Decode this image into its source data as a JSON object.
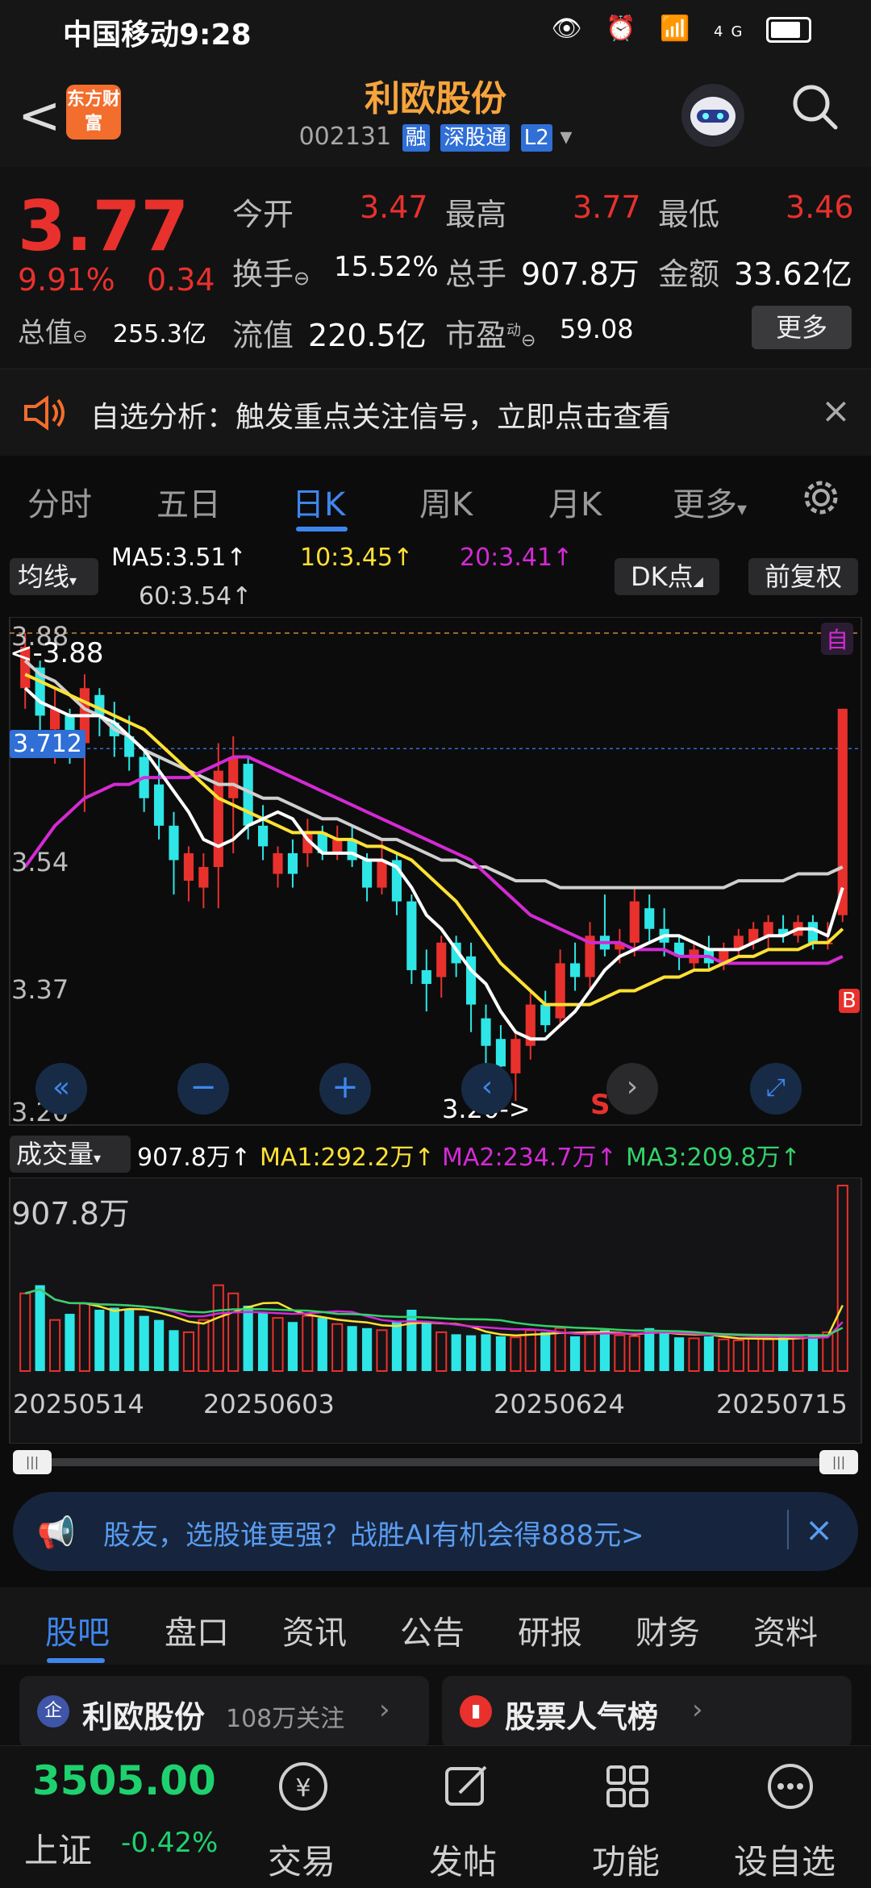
{
  "status_bar": {
    "carrier_time": "中国移动9:28",
    "network": "4G"
  },
  "header": {
    "back": "<",
    "logo_text": "东方财富",
    "title": "利欧股份",
    "code": "002131",
    "tags": [
      "融",
      "深股通",
      "L2"
    ]
  },
  "quote": {
    "price": "3.77",
    "pct_change": "9.91%",
    "change": "0.34",
    "open_label": "今开",
    "open": "3.47",
    "high_label": "最高",
    "high": "3.77",
    "low_label": "最低",
    "low": "3.46",
    "turnover_label": "换手",
    "turnover": "15.52%",
    "volume_label": "总手",
    "volume": "907.8万",
    "amount_label": "金额",
    "amount": "33.62亿",
    "mktcap_label": "总值",
    "mktcap": "255.3亿",
    "float_label": "流值",
    "float_cap": "220.5亿",
    "pe_label": "市盈",
    "pe_sup": "动",
    "pe": "59.08",
    "more": "更多"
  },
  "notice": {
    "text": "自选分析：触发重点关注信号，立即点击查看",
    "close": "×"
  },
  "chart_tabs": [
    "分时",
    "五日",
    "日K",
    "周K",
    "月K",
    "更多"
  ],
  "chart_tabs_active": "日K",
  "ma_bar": {
    "button": "均线",
    "ma5": "MA5:3.51↑",
    "ma10": "10:3.45↑",
    "ma20": "20:3.41↑",
    "ma60": "60:3.54↑",
    "dk": "DK点",
    "adjust": "前复权"
  },
  "price_axis": {
    "top": "3.88",
    "mid1": "3.54",
    "mid2": "3.37",
    "bottom": "3.20",
    "marker": "3.712"
  },
  "annotations": {
    "high_mark": "<-3.88",
    "low_mark": "3.20->",
    "sell": "S",
    "buy": "B",
    "self": "自"
  },
  "volume_bar": {
    "button": "成交量",
    "vol": "907.8万↑",
    "ma1": "MA1:292.2万↑",
    "ma2": "MA2:234.7万↑",
    "ma3": "MA3:209.8万↑",
    "axis_max": "907.8万"
  },
  "dates": [
    "20250514",
    "20250603",
    "20250624",
    "20250715"
  ],
  "colors": {
    "up": "#e8312c",
    "down": "#2ee6e6",
    "ma5": "#ffffff",
    "ma10": "#ffe133",
    "ma20": "#d42ad4",
    "ma60": "#cfcfcf"
  },
  "chart_data": {
    "type": "candlestick",
    "y_range": [
      3.2,
      3.88
    ],
    "candles": [
      {
        "o": 3.8,
        "h": 3.88,
        "l": 3.77,
        "c": 3.86
      },
      {
        "o": 3.83,
        "h": 3.84,
        "l": 3.73,
        "c": 3.76
      },
      {
        "o": 3.74,
        "h": 3.8,
        "l": 3.69,
        "c": 3.77
      },
      {
        "o": 3.76,
        "h": 3.77,
        "l": 3.69,
        "c": 3.71
      },
      {
        "o": 3.72,
        "h": 3.82,
        "l": 3.62,
        "c": 3.8
      },
      {
        "o": 3.79,
        "h": 3.8,
        "l": 3.73,
        "c": 3.76
      },
      {
        "o": 3.75,
        "h": 3.78,
        "l": 3.7,
        "c": 3.73
      },
      {
        "o": 3.73,
        "h": 3.76,
        "l": 3.68,
        "c": 3.7
      },
      {
        "o": 3.7,
        "h": 3.71,
        "l": 3.62,
        "c": 3.64
      },
      {
        "o": 3.66,
        "h": 3.7,
        "l": 3.58,
        "c": 3.6
      },
      {
        "o": 3.6,
        "h": 3.62,
        "l": 3.5,
        "c": 3.55
      },
      {
        "o": 3.52,
        "h": 3.57,
        "l": 3.49,
        "c": 3.56
      },
      {
        "o": 3.51,
        "h": 3.56,
        "l": 3.48,
        "c": 3.54
      },
      {
        "o": 3.54,
        "h": 3.72,
        "l": 3.48,
        "c": 3.68
      },
      {
        "o": 3.64,
        "h": 3.73,
        "l": 3.56,
        "c": 3.7
      },
      {
        "o": 3.69,
        "h": 3.7,
        "l": 3.58,
        "c": 3.6
      },
      {
        "o": 3.6,
        "h": 3.63,
        "l": 3.55,
        "c": 3.57
      },
      {
        "o": 3.53,
        "h": 3.57,
        "l": 3.51,
        "c": 3.56
      },
      {
        "o": 3.56,
        "h": 3.58,
        "l": 3.51,
        "c": 3.53
      },
      {
        "o": 3.56,
        "h": 3.61,
        "l": 3.54,
        "c": 3.59
      },
      {
        "o": 3.59,
        "h": 3.6,
        "l": 3.55,
        "c": 3.56
      },
      {
        "o": 3.56,
        "h": 3.6,
        "l": 3.55,
        "c": 3.58
      },
      {
        "o": 3.58,
        "h": 3.6,
        "l": 3.54,
        "c": 3.55
      },
      {
        "o": 3.55,
        "h": 3.56,
        "l": 3.49,
        "c": 3.51
      },
      {
        "o": 3.51,
        "h": 3.58,
        "l": 3.5,
        "c": 3.55
      },
      {
        "o": 3.55,
        "h": 3.56,
        "l": 3.47,
        "c": 3.49
      },
      {
        "o": 3.49,
        "h": 3.5,
        "l": 3.37,
        "c": 3.39
      },
      {
        "o": 3.39,
        "h": 3.42,
        "l": 3.33,
        "c": 3.37
      },
      {
        "o": 3.38,
        "h": 3.44,
        "l": 3.35,
        "c": 3.43
      },
      {
        "o": 3.43,
        "h": 3.44,
        "l": 3.38,
        "c": 3.4
      },
      {
        "o": 3.41,
        "h": 3.43,
        "l": 3.3,
        "c": 3.34
      },
      {
        "o": 3.32,
        "h": 3.34,
        "l": 3.25,
        "c": 3.28
      },
      {
        "o": 3.29,
        "h": 3.31,
        "l": 3.23,
        "c": 3.25
      },
      {
        "o": 3.24,
        "h": 3.3,
        "l": 3.2,
        "c": 3.29
      },
      {
        "o": 3.28,
        "h": 3.36,
        "l": 3.26,
        "c": 3.34
      },
      {
        "o": 3.34,
        "h": 3.36,
        "l": 3.3,
        "c": 3.31
      },
      {
        "o": 3.32,
        "h": 3.42,
        "l": 3.31,
        "c": 3.4
      },
      {
        "o": 3.4,
        "h": 3.43,
        "l": 3.36,
        "c": 3.38
      },
      {
        "o": 3.38,
        "h": 3.46,
        "l": 3.36,
        "c": 3.44
      },
      {
        "o": 3.44,
        "h": 3.5,
        "l": 3.41,
        "c": 3.42
      },
      {
        "o": 3.42,
        "h": 3.45,
        "l": 3.4,
        "c": 3.43
      },
      {
        "o": 3.43,
        "h": 3.51,
        "l": 3.41,
        "c": 3.49
      },
      {
        "o": 3.48,
        "h": 3.5,
        "l": 3.43,
        "c": 3.45
      },
      {
        "o": 3.45,
        "h": 3.48,
        "l": 3.41,
        "c": 3.43
      },
      {
        "o": 3.43,
        "h": 3.44,
        "l": 3.39,
        "c": 3.41
      },
      {
        "o": 3.4,
        "h": 3.43,
        "l": 3.39,
        "c": 3.42
      },
      {
        "o": 3.42,
        "h": 3.44,
        "l": 3.39,
        "c": 3.4
      },
      {
        "o": 3.4,
        "h": 3.43,
        "l": 3.39,
        "c": 3.42
      },
      {
        "o": 3.42,
        "h": 3.45,
        "l": 3.41,
        "c": 3.44
      },
      {
        "o": 3.43,
        "h": 3.46,
        "l": 3.42,
        "c": 3.45
      },
      {
        "o": 3.44,
        "h": 3.47,
        "l": 3.42,
        "c": 3.46
      },
      {
        "o": 3.45,
        "h": 3.47,
        "l": 3.43,
        "c": 3.44
      },
      {
        "o": 3.44,
        "h": 3.47,
        "l": 3.43,
        "c": 3.46
      },
      {
        "o": 3.46,
        "h": 3.47,
        "l": 3.42,
        "c": 3.43
      },
      {
        "o": 3.43,
        "h": 3.46,
        "l": 3.42,
        "c": 3.43
      },
      {
        "o": 3.47,
        "h": 3.77,
        "l": 3.46,
        "c": 3.77
      }
    ],
    "ma5": [
      3.8,
      3.78,
      3.77,
      3.76,
      3.76,
      3.76,
      3.75,
      3.73,
      3.71,
      3.68,
      3.65,
      3.62,
      3.58,
      3.57,
      3.58,
      3.6,
      3.61,
      3.62,
      3.61,
      3.58,
      3.56,
      3.56,
      3.56,
      3.55,
      3.55,
      3.54,
      3.51,
      3.47,
      3.45,
      3.42,
      3.39,
      3.37,
      3.33,
      3.3,
      3.29,
      3.29,
      3.31,
      3.33,
      3.36,
      3.39,
      3.41,
      3.42,
      3.43,
      3.44,
      3.44,
      3.43,
      3.42,
      3.42,
      3.42,
      3.43,
      3.44,
      3.44,
      3.45,
      3.45,
      3.44,
      3.51
    ],
    "ma10": [
      3.82,
      3.81,
      3.8,
      3.79,
      3.78,
      3.77,
      3.76,
      3.75,
      3.74,
      3.72,
      3.7,
      3.68,
      3.66,
      3.64,
      3.63,
      3.62,
      3.61,
      3.6,
      3.59,
      3.59,
      3.59,
      3.58,
      3.58,
      3.57,
      3.57,
      3.56,
      3.55,
      3.53,
      3.51,
      3.49,
      3.46,
      3.43,
      3.4,
      3.38,
      3.36,
      3.34,
      3.34,
      3.34,
      3.34,
      3.35,
      3.36,
      3.36,
      3.37,
      3.38,
      3.38,
      3.39,
      3.39,
      3.4,
      3.41,
      3.41,
      3.42,
      3.42,
      3.42,
      3.43,
      3.43,
      3.45
    ],
    "ma20": [
      3.54,
      3.57,
      3.6,
      3.62,
      3.64,
      3.65,
      3.66,
      3.66,
      3.67,
      3.67,
      3.67,
      3.67,
      3.68,
      3.69,
      3.7,
      3.7,
      3.69,
      3.68,
      3.67,
      3.66,
      3.65,
      3.64,
      3.63,
      3.62,
      3.61,
      3.6,
      3.59,
      3.58,
      3.57,
      3.56,
      3.55,
      3.53,
      3.51,
      3.49,
      3.47,
      3.46,
      3.45,
      3.44,
      3.43,
      3.43,
      3.43,
      3.42,
      3.42,
      3.42,
      3.41,
      3.41,
      3.41,
      3.4,
      3.4,
      3.4,
      3.4,
      3.4,
      3.4,
      3.4,
      3.4,
      3.41
    ],
    "ma60": [
      3.84,
      3.82,
      3.81,
      3.79,
      3.77,
      3.76,
      3.74,
      3.73,
      3.71,
      3.7,
      3.69,
      3.68,
      3.67,
      3.66,
      3.66,
      3.65,
      3.64,
      3.64,
      3.63,
      3.62,
      3.61,
      3.61,
      3.6,
      3.59,
      3.58,
      3.58,
      3.57,
      3.56,
      3.55,
      3.55,
      3.54,
      3.54,
      3.53,
      3.52,
      3.52,
      3.52,
      3.51,
      3.51,
      3.51,
      3.51,
      3.51,
      3.51,
      3.51,
      3.51,
      3.51,
      3.51,
      3.51,
      3.51,
      3.52,
      3.52,
      3.52,
      3.52,
      3.53,
      3.53,
      3.53,
      3.54
    ],
    "volume": [
      380,
      420,
      250,
      280,
      330,
      300,
      310,
      300,
      270,
      250,
      200,
      190,
      250,
      420,
      380,
      320,
      290,
      260,
      240,
      270,
      260,
      230,
      220,
      210,
      200,
      240,
      300,
      240,
      190,
      180,
      175,
      180,
      170,
      165,
      200,
      190,
      210,
      170,
      180,
      200,
      175,
      170,
      210,
      190,
      165,
      160,
      170,
      155,
      150,
      160,
      155,
      165,
      170,
      175,
      190,
      907.8
    ],
    "volume_ylim": [
      0,
      907.8
    ],
    "dates": [
      "20250514",
      "20250603",
      "20250624",
      "20250715"
    ],
    "markers": {
      "high": 3.88,
      "low": 3.2,
      "level": 3.712
    }
  },
  "range_handles": {
    "left": "|||",
    "right": "|||"
  },
  "promo": {
    "text": "股友，选股谁更强？战胜AI有机会得888元>",
    "close": "×"
  },
  "bottom_tabs": [
    "股吧",
    "盘口",
    "资讯",
    "公告",
    "研报",
    "财务",
    "资料"
  ],
  "bottom_tabs_active": "股吧",
  "cards": {
    "stock_name": "利欧股份",
    "followers": "108万关注",
    "card_badge": "企",
    "rank": "股票人气榜"
  },
  "nav": {
    "index_value": "3505.00",
    "index_name": "上证",
    "index_change": "-0.42%",
    "trade": "交易",
    "post": "发帖",
    "func": "功能",
    "watch": "设自选"
  }
}
